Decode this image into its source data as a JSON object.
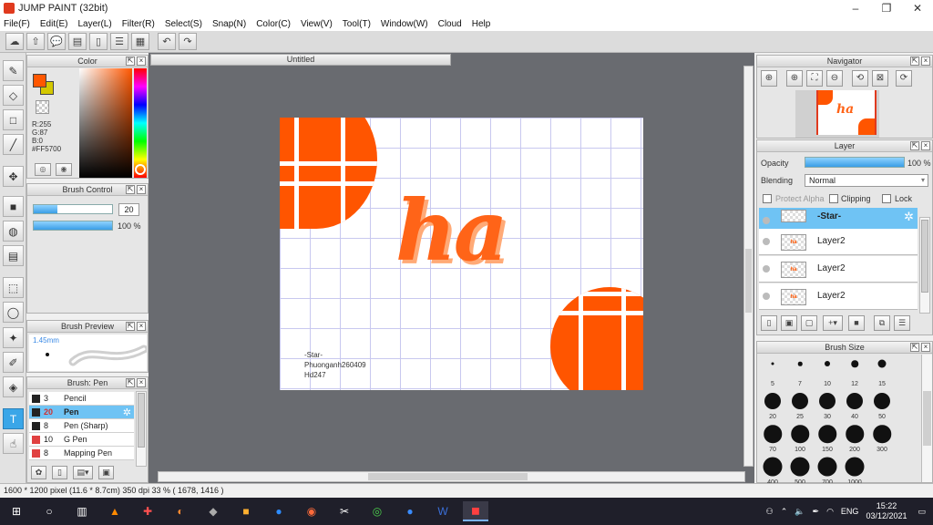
{
  "window": {
    "title": "JUMP PAINT (32bit)",
    "min": "–",
    "max": "❐",
    "close": "✕"
  },
  "menu": [
    "File(F)",
    "Edit(E)",
    "Layer(L)",
    "Filter(R)",
    "Select(S)",
    "Snap(N)",
    "Color(C)",
    "View(V)",
    "Tool(T)",
    "Window(W)",
    "Cloud",
    "Help"
  ],
  "toolbar_icons": [
    "cloud-icon",
    "share-icon",
    "chat-icon",
    "comment-icon",
    "document-icon",
    "settings-doc-icon",
    "grid-tools-icon",
    "undo-icon",
    "redo-icon"
  ],
  "toolbar_glyphs": [
    "☁",
    "⇧",
    "💬",
    "▤",
    "▯",
    "☰",
    "▦",
    "↶",
    "↷"
  ],
  "colors": {
    "accent": "#3aa6e8",
    "foreground": "#FF5700",
    "background_swatch": "#d4c800"
  },
  "color_panel": {
    "title": "Color",
    "r": "R:255",
    "g": "G:87",
    "b": "B:0",
    "hex": "#FF5700"
  },
  "brush_control": {
    "title": "Brush Control",
    "size": "20",
    "size_fraction": 0.3,
    "opacity": "100 %",
    "opacity_fraction": 1.0
  },
  "brush_preview": {
    "title": "Brush Preview",
    "size": "1.45mm"
  },
  "brush_list": {
    "title": "Brush: Pen",
    "items": [
      {
        "size": "3",
        "name": "Pencil",
        "color": "#222222"
      },
      {
        "size": "20",
        "name": "Pen",
        "color": "#222222"
      },
      {
        "size": "8",
        "name": "Pen (Sharp)",
        "color": "#222222"
      },
      {
        "size": "10",
        "name": "G Pen",
        "color": "#e04040"
      },
      {
        "size": "8",
        "name": "Mapping Pen",
        "color": "#e04040"
      }
    ]
  },
  "document": {
    "tab": "Untitled",
    "art_text": "ha",
    "credit": [
      "-Star-",
      "Phuonganh260409",
      "Hd247"
    ]
  },
  "navigator": {
    "title": "Navigator",
    "thumb_text": "ha"
  },
  "layer_panel": {
    "title": "Layer",
    "opacity_label": "Opacity",
    "opacity_value": "100 %",
    "blending_label": "Blending",
    "blending_value": "Normal",
    "protect_alpha": "Protect Alpha",
    "clipping": "Clipping",
    "lock": "Lock",
    "layers": [
      {
        "name": "-Star-",
        "thumb": ""
      },
      {
        "name": "Layer2",
        "thumb": "ha"
      },
      {
        "name": "Layer2",
        "thumb": "ha"
      },
      {
        "name": "Layer2",
        "thumb": "ha"
      }
    ]
  },
  "brush_size": {
    "title": "Brush Size",
    "values": [
      "5",
      "7",
      "10",
      "12",
      "15",
      "20",
      "25",
      "30",
      "40",
      "50",
      "70",
      "100",
      "150",
      "200",
      "300",
      "400",
      "500",
      "700",
      "1000"
    ]
  },
  "status": "1600 * 1200 pixel  (11.6 * 8.7cm)  350 dpi  33 %  ( 1678, 1416 )",
  "taskbar": {
    "lang": "ENG",
    "time": "15:22",
    "date": "03/12/2021",
    "apps": [
      "start-icon",
      "search-icon",
      "task-view-icon",
      "vlc-icon",
      "app-icon",
      "app-icon",
      "app-icon",
      "app-icon",
      "zoom-icon",
      "app-icon",
      "capcut-icon",
      "app-icon",
      "zalo-icon",
      "word-icon",
      "jumppaint-icon"
    ]
  }
}
